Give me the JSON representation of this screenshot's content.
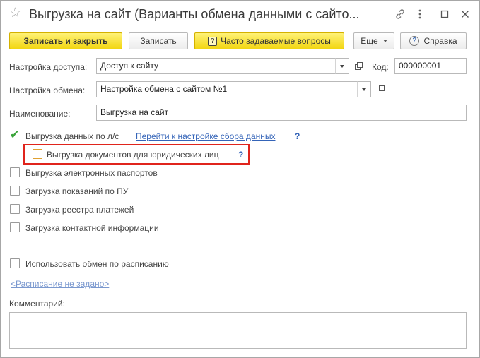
{
  "window": {
    "title": "Выгрузка на сайт (Варианты обмена данными с сайто..."
  },
  "toolbar": {
    "save_close": "Записать и закрыть",
    "save": "Записать",
    "faq": "Часто задаваемые вопросы",
    "more": "Еще",
    "help": "Справка"
  },
  "form": {
    "access_label": "Настройка доступа:",
    "access_value": "Доступ к сайту",
    "code_label": "Код:",
    "code_value": "000000001",
    "exchange_label": "Настройка обмена:",
    "exchange_value": "Настройка обмена с сайтом №1",
    "name_label": "Наименование:",
    "name_value": "Выгрузка на сайт"
  },
  "options": {
    "export_ls": {
      "label": "Выгрузка данных по л/с",
      "checked": true
    },
    "goto_link": "Перейти к настройке сбора данных",
    "help_q": "?",
    "export_legal": {
      "label": "Выгрузка документов для юридических лиц",
      "checked": false
    },
    "export_passports": {
      "label": "Выгрузка электронных паспортов",
      "checked": false
    },
    "load_readings": {
      "label": "Загрузка показаний по ПУ",
      "checked": false
    },
    "load_payments": {
      "label": "Загрузка реестра платежей",
      "checked": false
    },
    "load_contacts": {
      "label": "Загрузка контактной информации",
      "checked": false
    },
    "schedule": {
      "label": "Использовать обмен по расписанию",
      "checked": false
    },
    "schedule_link": "<Расписание не задано>"
  },
  "comment": {
    "label": "Комментарий:",
    "value": ""
  },
  "colors": {
    "accent_yellow": "#f2d612",
    "link_blue": "#3464b8",
    "highlight_red": "#e0241c",
    "check_green": "#3aa43a"
  }
}
